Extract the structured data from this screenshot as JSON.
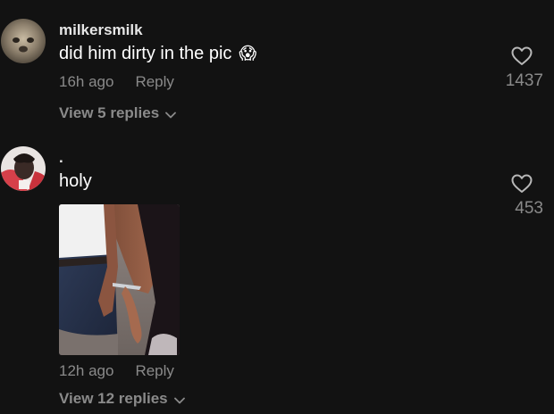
{
  "comments": [
    {
      "username": "milkersmilk",
      "text": "did him dirty in the pic",
      "emoji": "😱",
      "time": "16h ago",
      "reply_label": "Reply",
      "likes": "1437",
      "replies_label": "View 5 replies"
    },
    {
      "username": ".",
      "text": "holy",
      "time": "12h ago",
      "reply_label": "Reply",
      "likes": "453",
      "replies_label": "View 12 replies"
    }
  ],
  "icons": {
    "like": "heart-outline-icon",
    "expand": "chevron-down-icon"
  },
  "colors": {
    "background": "#121212",
    "primary_text": "#ffffff",
    "secondary_text": "#8a8a8a"
  }
}
